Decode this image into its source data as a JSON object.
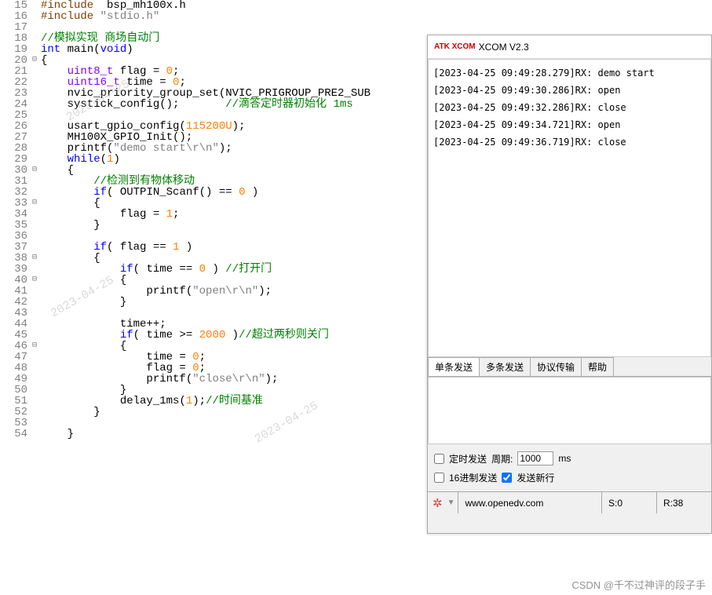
{
  "code": {
    "lines": [
      {
        "n": 15,
        "f": "",
        "parts": [
          [
            "c-pre",
            "#include"
          ],
          [
            "c-id",
            "  bsp_mh100x.h"
          ]
        ]
      },
      {
        "n": 16,
        "f": "",
        "parts": [
          [
            "c-pre",
            "#include"
          ],
          [
            "c-id",
            " "
          ],
          [
            "c-str",
            "\"stdio.h\""
          ]
        ]
      },
      {
        "n": 17,
        "f": "",
        "parts": [
          [
            "c-id",
            ""
          ]
        ]
      },
      {
        "n": 18,
        "f": "",
        "parts": [
          [
            "c-cmt",
            "//模拟实现 商场自动门"
          ]
        ]
      },
      {
        "n": 19,
        "f": "",
        "parts": [
          [
            "c-kw",
            "int"
          ],
          [
            "c-id",
            " "
          ],
          [
            "c-fn",
            "main"
          ],
          [
            "c-id",
            "("
          ],
          [
            "c-kw",
            "void"
          ],
          [
            "c-id",
            ")"
          ]
        ]
      },
      {
        "n": 20,
        "f": "⊟",
        "parts": [
          [
            "c-id",
            "{"
          ]
        ]
      },
      {
        "n": 21,
        "f": "",
        "parts": [
          [
            "c-id",
            "    "
          ],
          [
            "c-type",
            "uint8_t"
          ],
          [
            "c-id",
            " flag = "
          ],
          [
            "c-num",
            "0"
          ],
          [
            "c-id",
            ";"
          ]
        ]
      },
      {
        "n": 22,
        "f": "",
        "parts": [
          [
            "c-id",
            "    "
          ],
          [
            "c-type",
            "uint16_t"
          ],
          [
            "c-id",
            " time = "
          ],
          [
            "c-num",
            "0"
          ],
          [
            "c-id",
            ";"
          ]
        ]
      },
      {
        "n": 23,
        "f": "",
        "parts": [
          [
            "c-id",
            "    nvic_priority_group_set(NVIC_PRIGROUP_PRE2_SUB"
          ]
        ]
      },
      {
        "n": 24,
        "f": "",
        "parts": [
          [
            "c-id",
            "    systick_config();       "
          ],
          [
            "c-cmt",
            "//滴答定时器初始化 1ms"
          ]
        ]
      },
      {
        "n": 25,
        "f": "",
        "parts": [
          [
            "c-id",
            ""
          ]
        ]
      },
      {
        "n": 26,
        "f": "",
        "parts": [
          [
            "c-id",
            "    usart_gpio_config("
          ],
          [
            "c-num",
            "115200U"
          ],
          [
            "c-id",
            ");"
          ]
        ]
      },
      {
        "n": 27,
        "f": "",
        "parts": [
          [
            "c-id",
            "    MH100X_GPIO_Init();"
          ]
        ]
      },
      {
        "n": 28,
        "f": "",
        "parts": [
          [
            "c-id",
            "    printf("
          ],
          [
            "c-str",
            "\"demo start\\r\\n\""
          ],
          [
            "c-id",
            ");"
          ]
        ]
      },
      {
        "n": 29,
        "f": "",
        "parts": [
          [
            "c-id",
            "    "
          ],
          [
            "c-kw",
            "while"
          ],
          [
            "c-id",
            "("
          ],
          [
            "c-num",
            "1"
          ],
          [
            "c-id",
            ")"
          ]
        ]
      },
      {
        "n": 30,
        "f": "⊟",
        "parts": [
          [
            "c-id",
            "    {"
          ]
        ]
      },
      {
        "n": 31,
        "f": "",
        "parts": [
          [
            "c-id",
            "        "
          ],
          [
            "c-cmt",
            "//检测到有物体移动"
          ]
        ]
      },
      {
        "n": 32,
        "f": "",
        "parts": [
          [
            "c-id",
            "        "
          ],
          [
            "c-kw",
            "if"
          ],
          [
            "c-id",
            "( OUTPIN_Scanf() == "
          ],
          [
            "c-num",
            "0"
          ],
          [
            "c-id",
            " )"
          ]
        ]
      },
      {
        "n": 33,
        "f": "⊟",
        "parts": [
          [
            "c-id",
            "        {"
          ]
        ]
      },
      {
        "n": 34,
        "f": "",
        "parts": [
          [
            "c-id",
            "            flag = "
          ],
          [
            "c-num",
            "1"
          ],
          [
            "c-id",
            ";"
          ]
        ]
      },
      {
        "n": 35,
        "f": "",
        "parts": [
          [
            "c-id",
            "        }"
          ]
        ]
      },
      {
        "n": 36,
        "f": "",
        "parts": [
          [
            "c-id",
            ""
          ]
        ]
      },
      {
        "n": 37,
        "f": "",
        "parts": [
          [
            "c-id",
            "        "
          ],
          [
            "c-kw",
            "if"
          ],
          [
            "c-id",
            "( flag == "
          ],
          [
            "c-num",
            "1"
          ],
          [
            "c-id",
            " )"
          ]
        ]
      },
      {
        "n": 38,
        "f": "⊟",
        "parts": [
          [
            "c-id",
            "        {"
          ]
        ]
      },
      {
        "n": 39,
        "f": "",
        "parts": [
          [
            "c-id",
            "            "
          ],
          [
            "c-kw",
            "if"
          ],
          [
            "c-id",
            "( time == "
          ],
          [
            "c-num",
            "0"
          ],
          [
            "c-id",
            " ) "
          ],
          [
            "c-cmt",
            "//打开门"
          ]
        ]
      },
      {
        "n": 40,
        "f": "⊟",
        "parts": [
          [
            "c-id",
            "            {"
          ]
        ]
      },
      {
        "n": 41,
        "f": "",
        "parts": [
          [
            "c-id",
            "                printf("
          ],
          [
            "c-str",
            "\"open\\r\\n\""
          ],
          [
            "c-id",
            ");"
          ]
        ]
      },
      {
        "n": 42,
        "f": "",
        "parts": [
          [
            "c-id",
            "            }"
          ]
        ]
      },
      {
        "n": 43,
        "f": "",
        "parts": [
          [
            "c-id",
            ""
          ]
        ]
      },
      {
        "n": 44,
        "f": "",
        "parts": [
          [
            "c-id",
            "            time++;"
          ]
        ]
      },
      {
        "n": 45,
        "f": "",
        "parts": [
          [
            "c-id",
            "            "
          ],
          [
            "c-kw",
            "if"
          ],
          [
            "c-id",
            "( time >= "
          ],
          [
            "c-num",
            "2000"
          ],
          [
            "c-id",
            " )"
          ],
          [
            "c-cmt",
            "//超过两秒则关门"
          ]
        ]
      },
      {
        "n": 46,
        "f": "⊟",
        "parts": [
          [
            "c-id",
            "            {"
          ]
        ]
      },
      {
        "n": 47,
        "f": "",
        "parts": [
          [
            "c-id",
            "                time = "
          ],
          [
            "c-num",
            "0"
          ],
          [
            "c-id",
            ";"
          ]
        ]
      },
      {
        "n": 48,
        "f": "",
        "parts": [
          [
            "c-id",
            "                flag = "
          ],
          [
            "c-num",
            "0"
          ],
          [
            "c-id",
            ";"
          ]
        ]
      },
      {
        "n": 49,
        "f": "",
        "parts": [
          [
            "c-id",
            "                printf("
          ],
          [
            "c-str",
            "\"close\\r\\n\""
          ],
          [
            "c-id",
            ");"
          ]
        ]
      },
      {
        "n": 50,
        "f": "",
        "parts": [
          [
            "c-id",
            "            }"
          ]
        ]
      },
      {
        "n": 51,
        "f": "",
        "parts": [
          [
            "c-id",
            "            delay_1ms("
          ],
          [
            "c-num",
            "1"
          ],
          [
            "c-id",
            ");"
          ],
          [
            "c-cmt",
            "//时间基准"
          ]
        ]
      },
      {
        "n": 52,
        "f": "",
        "parts": [
          [
            "c-id",
            "        }"
          ]
        ]
      },
      {
        "n": 53,
        "f": "",
        "parts": [
          [
            "c-id",
            ""
          ]
        ]
      },
      {
        "n": 54,
        "f": "",
        "parts": [
          [
            "c-id",
            "    }"
          ]
        ]
      }
    ]
  },
  "xcom": {
    "logo": "ATK\nXCOM",
    "title": "XCOM V2.3",
    "output_lines": [
      "[2023-04-25 09:49:28.279]RX: demo start",
      "[2023-04-25 09:49:30.286]RX: open",
      "[2023-04-25 09:49:32.286]RX: close",
      "[2023-04-25 09:49:34.721]RX: open",
      "[2023-04-25 09:49:36.719]RX: close"
    ],
    "tabs": [
      "单条发送",
      "多条发送",
      "协议传输",
      "帮助"
    ],
    "opt1_label": "定时发送",
    "opt1_period_label": "周期:",
    "opt1_period_value": "1000",
    "opt1_ms": "ms",
    "opt2_label": "16进制发送",
    "opt3_label": "发送新行",
    "status_url": "www.openedv.com",
    "status_s": "S:0",
    "status_r": "R:38"
  },
  "csdn": "CSDN @千不过神评的段子手"
}
